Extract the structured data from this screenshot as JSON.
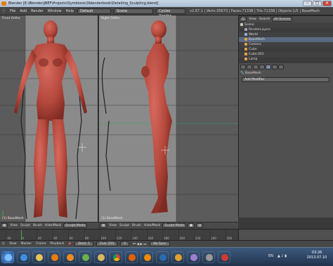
{
  "window": {
    "title": "Blender [E:\\Blender\\JBEF\\Projects\\Symbiosis\\3blenderbook\\Detailing_Sculpting.blend]",
    "min": "–",
    "max": "□",
    "close": "✕"
  },
  "info_header": {
    "menus": [
      "File",
      "Add",
      "Render",
      "Window",
      "Help"
    ],
    "layout": "Default",
    "scene": "Scene",
    "engine": "Cycles Render",
    "stats": "v2.67.1 | Verts:35673 | Faces:71338 | Tris:71338 | Objects:1/5 | BaseMesh"
  },
  "viewports": {
    "left": {
      "label": "Front Ortho",
      "object": "(1) BaseMesh"
    },
    "right": {
      "label": "Right Ortho",
      "object": "(1) BaseMesh"
    }
  },
  "vp_header": {
    "view": "View",
    "sculpt": "Sculpt",
    "brush": "Brush",
    "hide": "Hide/Mask",
    "mode": "Sculpt Mode"
  },
  "outliner": {
    "header": {
      "view": "View",
      "search": "Search",
      "filter": "All Scenes"
    },
    "rows": [
      {
        "text": "Scene",
        "color": "#c9c9c9"
      },
      {
        "text": "RenderLayers",
        "color": "#9aa9c8"
      },
      {
        "text": "World",
        "color": "#8fb0d8"
      },
      {
        "text": "BaseMesh",
        "color": "#e8a24a"
      },
      {
        "text": "Camera",
        "color": "#e8a24a"
      },
      {
        "text": "Cube",
        "color": "#e8a24a"
      },
      {
        "text": "Cube.001",
        "color": "#e8a24a"
      },
      {
        "text": "Lamp",
        "color": "#e8a24a"
      }
    ]
  },
  "properties": {
    "object": "BaseMesh",
    "add_modifier": "Add Modifier"
  },
  "timeline": {
    "ticks": [
      "-20",
      "0",
      "20",
      "40",
      "60",
      "80",
      "100",
      "120",
      "140",
      "160",
      "180",
      "200",
      "220",
      "240",
      "260"
    ]
  },
  "timeline_bar": {
    "view": "View",
    "marker": "Marker",
    "frame": "Frame",
    "playback": "Playback",
    "start": "Start: 1",
    "end": "End: 250",
    "current": "0",
    "sync": "No Sync"
  },
  "taskbar": {
    "lang": "EN",
    "time": "03:26",
    "date": "2013.07.10"
  },
  "colors": {
    "clay": "#b5483c",
    "clay_shadow": "#7d2a22",
    "viewport": "#5b5b5b",
    "reference_bg": "#8a8a8a"
  }
}
